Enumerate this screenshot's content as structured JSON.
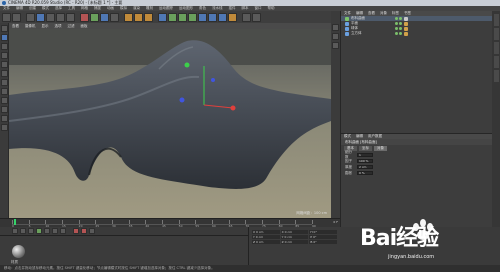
{
  "window": {
    "title": "CINEMA 4D R20.059 Studio (RC - R20) - [未标题 1 *] - 主要"
  },
  "menubar": {
    "items": [
      "文件",
      "编辑",
      "创建",
      "模式",
      "选择",
      "工具",
      "网格",
      "捕捉",
      "动画",
      "模拟",
      "渲染",
      "雕刻",
      "运动跟踪",
      "运动图形",
      "角色",
      "流水线",
      "插件",
      "脚本",
      "窗口",
      "帮助"
    ]
  },
  "viewport": {
    "menu": [
      "查看",
      "摄像机",
      "显示",
      "选项",
      "过滤",
      "面板"
    ],
    "label": "网格间距：100 cm"
  },
  "object_manager": {
    "menu": [
      "文件",
      "编辑",
      "查看",
      "对象",
      "标签",
      "书签"
    ],
    "objects": [
      {
        "name": "布料曲面",
        "color": "#7cc46b"
      },
      {
        "name": "平面",
        "color": "#6aa0e0"
      },
      {
        "name": "球体",
        "color": "#6aa0e0"
      },
      {
        "name": "立方体",
        "color": "#6aa0e0"
      }
    ]
  },
  "attribute_manager": {
    "menu": [
      "模式",
      "编辑",
      "用户数据"
    ],
    "title": "布料曲面 [布料曲面]",
    "tabs": [
      "基本",
      "坐标",
      "对象"
    ],
    "rows": [
      {
        "label": "细分数",
        "value": "1"
      },
      {
        "label": "因子",
        "value": "100 %"
      },
      {
        "label": "厚度",
        "value": "2 cm"
      },
      {
        "label": "膨胀",
        "value": "0 %"
      }
    ]
  },
  "timeline": {
    "ticks": [
      "0",
      "5",
      "10",
      "15",
      "20",
      "25",
      "30",
      "35",
      "40",
      "45",
      "50",
      "55",
      "60",
      "65",
      "70",
      "75",
      "80",
      "85",
      "90"
    ],
    "end": "0 F"
  },
  "material_manager": {
    "label": "材质"
  },
  "coordinates": {
    "cells": [
      "X 0 cm",
      "X 0 cm",
      "H 0°",
      "Y 0 cm",
      "Y 0 cm",
      "P 0°",
      "Z 0 cm",
      "Z 0 cm",
      "B 0°"
    ]
  },
  "statusbar": {
    "text": "移动：点击并拖动鼠标移动元素。按住 SHIFT 键量化移动；节点编辑模式时按住 SHIFT 键增加选择对象；按住 CTRL 键减少选择对象。"
  },
  "watermark": {
    "brand": "Bai经验",
    "url": "jingyan.baidu.com"
  }
}
